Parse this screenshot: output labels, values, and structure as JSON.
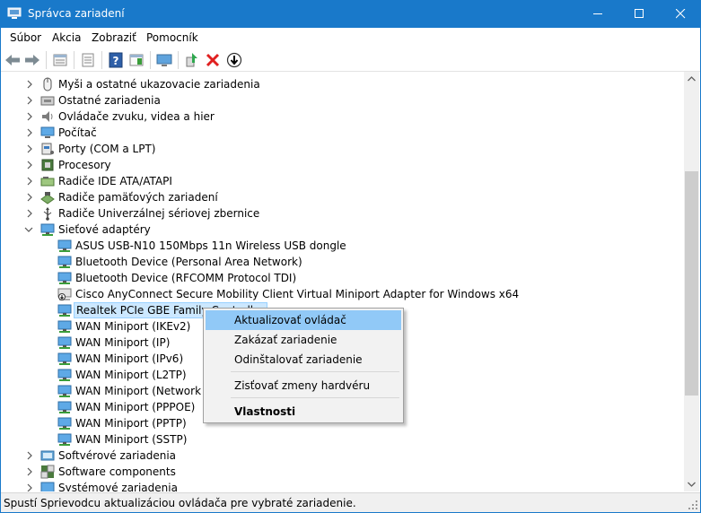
{
  "window": {
    "title": "Správca zariadení",
    "accent": "#1979ca",
    "buttons": [
      "minimize-icon",
      "maximize-icon",
      "close-icon"
    ]
  },
  "menubar": [
    "Súbor",
    "Akcia",
    "Zobraziť",
    "Pomocník"
  ],
  "toolbar": [
    "back-arrow-icon",
    "forward-arrow-icon",
    "properties-sheet-icon",
    "list-view-icon",
    "help-icon",
    "action-pane-icon",
    "monitor-icon",
    "update-driver-icon",
    "uninstall-red-x-icon",
    "download-arrow-icon"
  ],
  "tree": {
    "categories_top": [
      {
        "label": "Myši a ostatné ukazovacie zariadenia",
        "icon": "mouse-icon"
      },
      {
        "label": "Ostatné zariadenia",
        "icon": "unknown-device-icon"
      },
      {
        "label": "Ovládače zvuku, videa a hier",
        "icon": "speaker-icon"
      },
      {
        "label": "Počítač",
        "icon": "computer-icon"
      },
      {
        "label": "Porty (COM a LPT)",
        "icon": "port-icon"
      },
      {
        "label": "Procesory",
        "icon": "cpu-icon"
      },
      {
        "label": "Radiče IDE ATA/ATAPI",
        "icon": "disk-controller-icon"
      },
      {
        "label": "Radiče pamäťových zariadení",
        "icon": "storage-controller-icon"
      },
      {
        "label": "Radiče Univerzálnej sériovej zbernice",
        "icon": "usb-icon"
      }
    ],
    "network_category": {
      "label": "Sieťové adaptéry",
      "icon": "network-adapter-icon",
      "expanded": true
    },
    "network_children": [
      {
        "label": "ASUS USB-N10 150Mbps 11n Wireless USB dongle",
        "icon": "network-adapter-icon"
      },
      {
        "label": "Bluetooth Device (Personal Area Network)",
        "icon": "network-adapter-icon"
      },
      {
        "label": "Bluetooth Device (RFCOMM Protocol TDI)",
        "icon": "network-adapter-icon"
      },
      {
        "label": "Cisco AnyConnect Secure Mobility Client Virtual Miniport Adapter for Windows x64",
        "icon": "network-adapter-disabled-icon"
      },
      {
        "label": "Realtek PCIe GBE Family Controller",
        "icon": "network-adapter-icon",
        "selected": true
      },
      {
        "label": "WAN Miniport (IKEv2)",
        "icon": "network-adapter-icon"
      },
      {
        "label": "WAN Miniport (IP)",
        "icon": "network-adapter-icon"
      },
      {
        "label": "WAN Miniport (IPv6)",
        "icon": "network-adapter-icon"
      },
      {
        "label": "WAN Miniport (L2TP)",
        "icon": "network-adapter-icon"
      },
      {
        "label": "WAN Miniport (Network Monitor)",
        "icon": "network-adapter-icon"
      },
      {
        "label": "WAN Miniport (PPPOE)",
        "icon": "network-adapter-icon"
      },
      {
        "label": "WAN Miniport (PPTP)",
        "icon": "network-adapter-icon"
      },
      {
        "label": "WAN Miniport (SSTP)",
        "icon": "network-adapter-icon"
      }
    ],
    "categories_bottom": [
      {
        "label": "Softvérové zariadenia",
        "icon": "software-device-icon"
      },
      {
        "label": "Software components",
        "icon": "software-components-icon"
      },
      {
        "label": "Systémové zariadenia",
        "icon": "system-device-icon"
      }
    ]
  },
  "context_menu": {
    "items": [
      "Aktualizovať ovládač",
      "Zakázať zariadenie",
      "Odinštalovať zariadenie",
      "Zisťovať zmeny hardvéru",
      "Vlastnosti"
    ],
    "highlighted": "Aktualizovať ovládač",
    "bold": "Vlastnosti"
  },
  "statusbar": {
    "text": "Spustí Sprievodcu aktualizáciou ovládača pre vybraté zariadenie."
  }
}
